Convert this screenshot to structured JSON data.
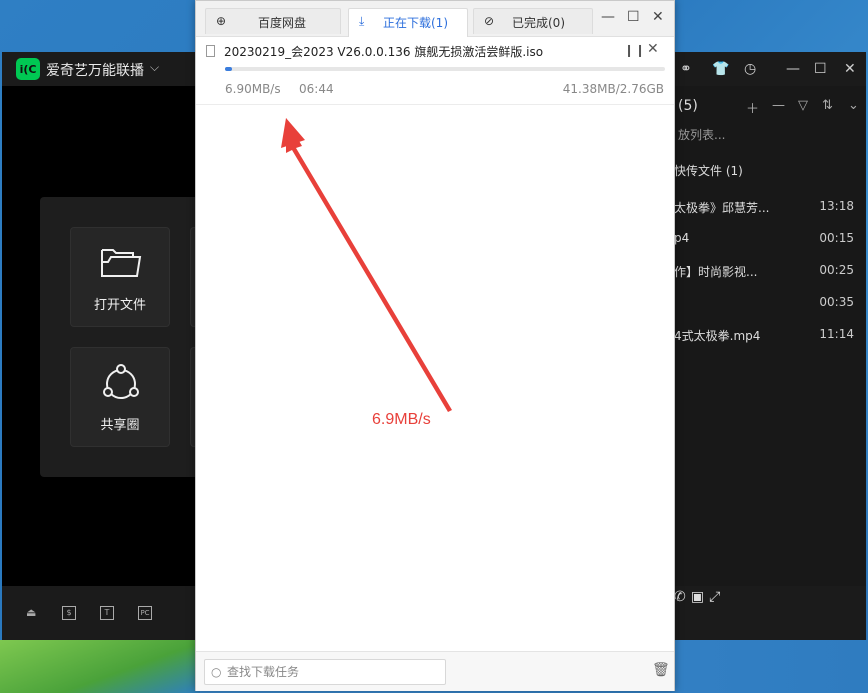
{
  "player": {
    "title": "爱奇艺万能联播",
    "logo_text": "i(C",
    "tiles": [
      {
        "label": "打开文件",
        "icon": "folder-icon"
      },
      {
        "label": "共享圈",
        "icon": "share-icon"
      }
    ],
    "playlist": {
      "header": "(5)",
      "search_placeholder": "放列表...",
      "folder": "快传文件 (1)",
      "items": [
        {
          "name": "太极拳》邱慧芳...",
          "duration": "13:18"
        },
        {
          "name": "p4",
          "duration": "00:15"
        },
        {
          "name": "作】时尚影视...",
          "duration": "00:25"
        },
        {
          "name": "",
          "duration": "00:35"
        },
        {
          "name": "4式太极拳.mp4",
          "duration": "11:14"
        }
      ]
    }
  },
  "download_manager": {
    "tabs": [
      {
        "label": "百度网盘",
        "icon": "globe-icon",
        "active": false
      },
      {
        "label": "正在下载(1)",
        "icon": "download-icon",
        "active": true
      },
      {
        "label": "已完成(0)",
        "icon": "check-circle-icon",
        "active": false
      }
    ],
    "item": {
      "file_name": "20230219_会2023 V26.0.0.136 旗舰无损激活尝鲜版.iso",
      "speed": "6.90MB/s",
      "eta": "06:44",
      "size": "41.38MB/2.76GB",
      "progress": 0.015
    },
    "search_placeholder": "查找下载任务"
  },
  "annotation": {
    "text": "6.9MB/s",
    "color": "#e8403a"
  },
  "colors": {
    "accent": "#3b7ddd",
    "player_brand": "#00c853"
  }
}
